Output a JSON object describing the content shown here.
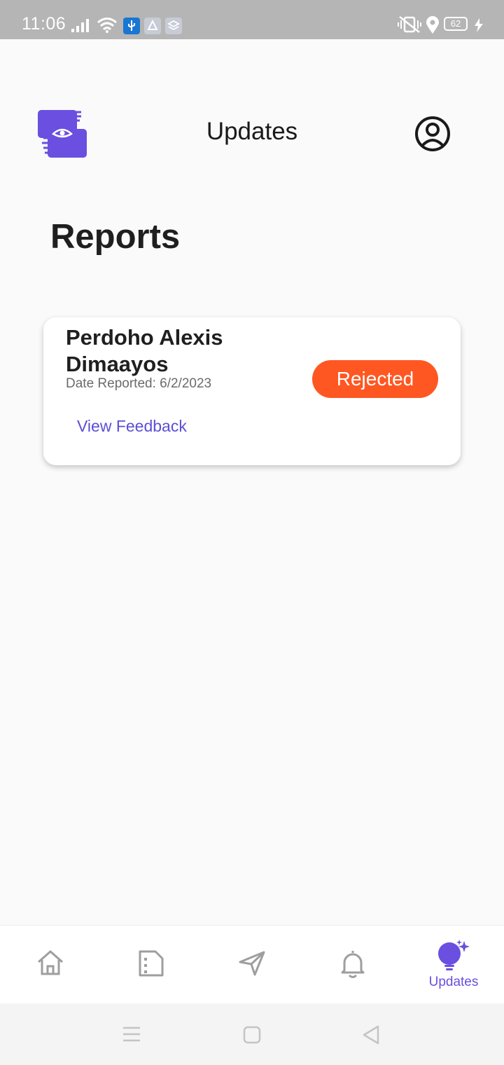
{
  "status_bar": {
    "time": "11:06",
    "battery": "62",
    "icons": [
      "signal-icon",
      "wifi-icon",
      "usb-icon",
      "share-icon",
      "layers-icon",
      "vibrate-icon",
      "location-icon",
      "battery-icon",
      "charging-icon"
    ]
  },
  "header": {
    "title": "Updates",
    "logo": "hand-eye-logo",
    "profile_icon": "account-circle-icon"
  },
  "section": {
    "title": "Reports"
  },
  "reports": [
    {
      "name": "Perdoho Alexis Dimaayos",
      "date_label": "Date Reported: ",
      "date": "6/2/2023",
      "status": "Rejected",
      "link": "View Feedback"
    }
  ],
  "bottom_nav": {
    "items": [
      {
        "icon": "home-icon",
        "label": ""
      },
      {
        "icon": "document-icon",
        "label": ""
      },
      {
        "icon": "send-icon",
        "label": ""
      },
      {
        "icon": "bell-icon",
        "label": ""
      },
      {
        "icon": "lightbulb-sparkle-icon",
        "label": "Updates",
        "active": true
      }
    ]
  },
  "colors": {
    "accent": "#6a4fe0",
    "rejected": "#ff5722",
    "inactive_icon": "#9e9e9e"
  }
}
